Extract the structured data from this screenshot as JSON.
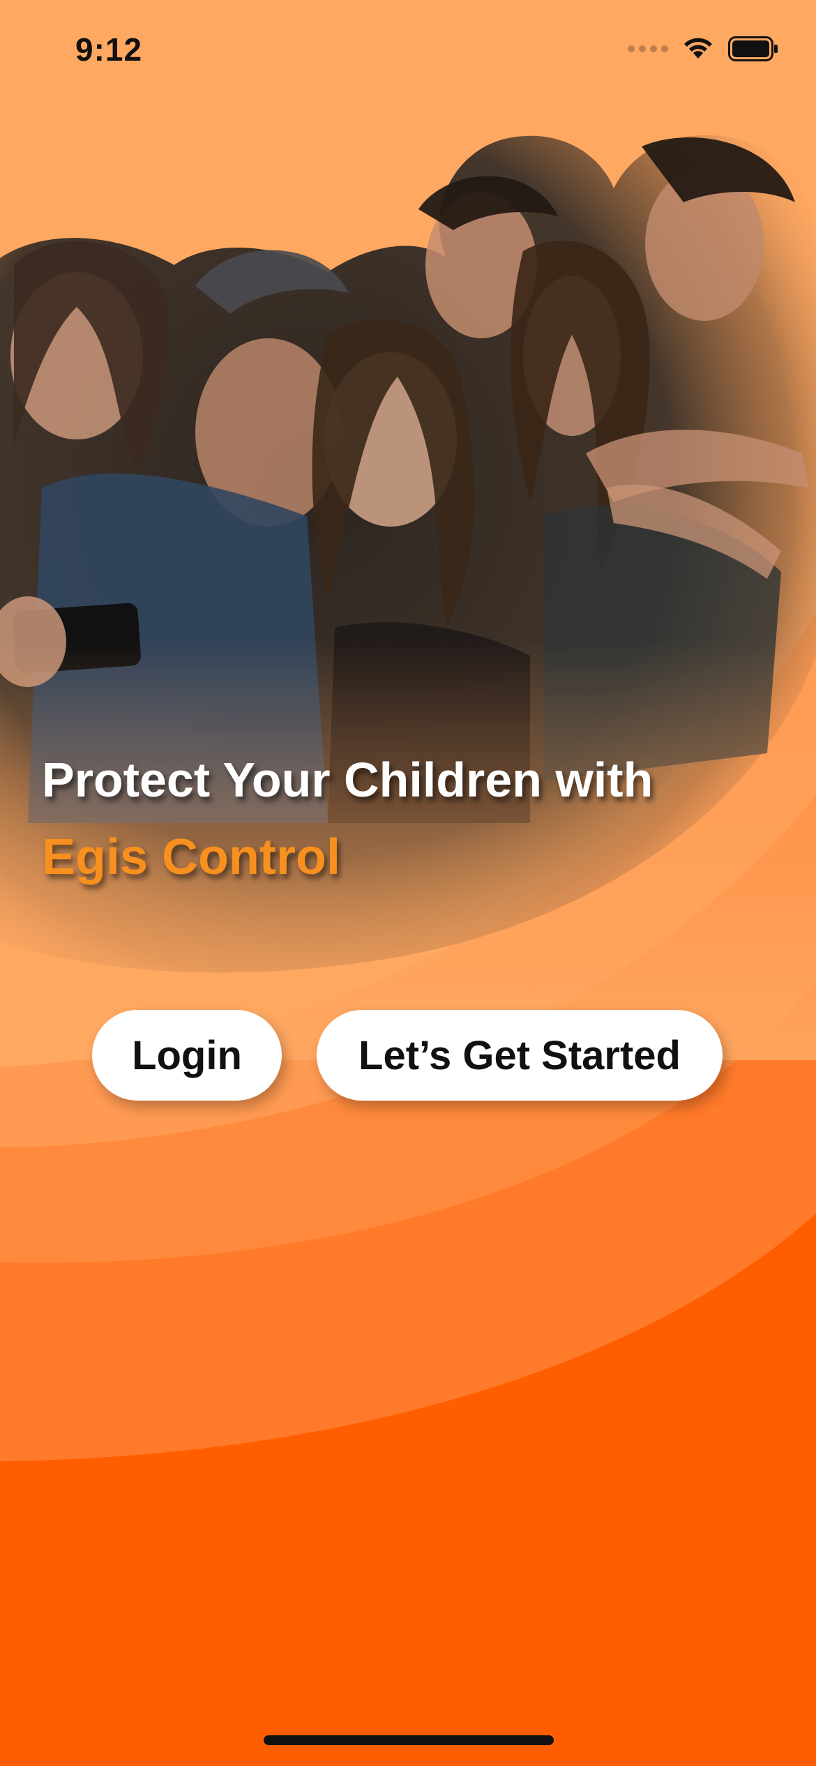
{
  "status_bar": {
    "time": "9:12",
    "icons": [
      "cellular-signal-icon",
      "wifi-icon",
      "battery-icon"
    ]
  },
  "hero": {
    "image": "family-group-selfie-photo"
  },
  "content": {
    "headline": "Protect Your Children with",
    "brand_name": "Egis Control"
  },
  "actions": {
    "login_label": "Login",
    "get_started_label": "Let’s Get Started"
  },
  "colors": {
    "background_light": "#ffb06d",
    "background_dark": "#ff5e00",
    "brand_accent": "#f7901e",
    "button_bg": "#ffffff",
    "button_text": "#111111"
  }
}
